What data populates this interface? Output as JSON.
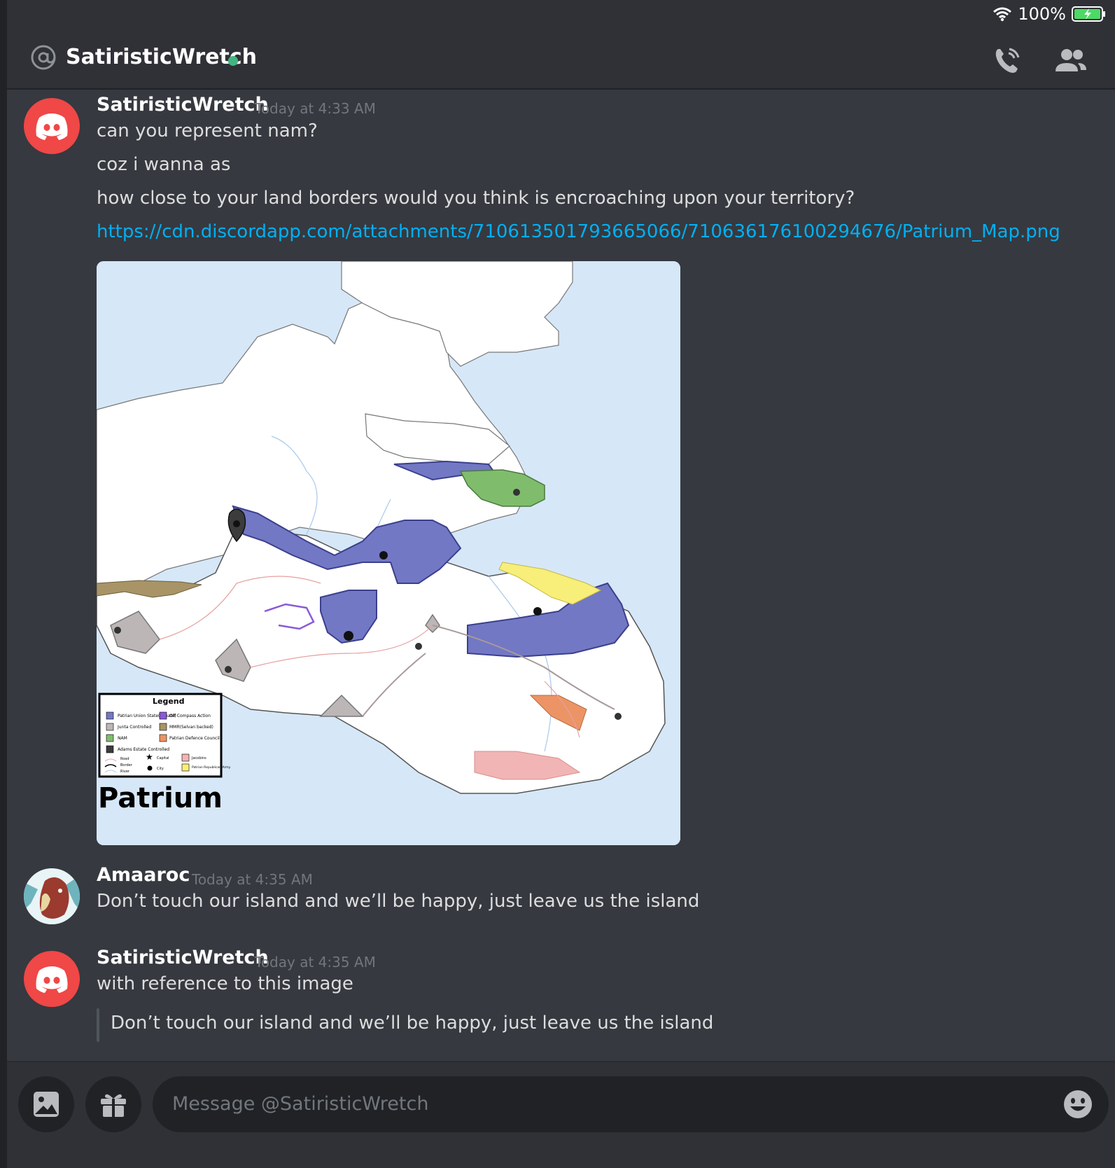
{
  "status_bar": {
    "battery": "100%"
  },
  "header": {
    "channel_name": "SatiristicWretch",
    "status": "online"
  },
  "messages": [
    {
      "author": "SatiristicWretch",
      "timestamp": "Today at 4:33 AM",
      "lines": [
        "can you represent nam?",
        "coz i wanna as",
        "how close to your land borders would you think is encroaching upon your territory?"
      ],
      "link": "https://cdn.discordapp.com/attachments/710613501793665066/710636176100294676/Patrium_Map.png"
    },
    {
      "author": "Amaaroc",
      "timestamp": "Today at 4:35 AM",
      "lines": [
        "Don’t touch our island and we’ll be happy, just leave us the island"
      ]
    },
    {
      "author": "SatiristicWretch",
      "timestamp": "Today at 4:35 AM",
      "lines": [
        "with reference to this image"
      ],
      "quote": "Don’t touch our island and we’ll be happy, just leave us the island"
    }
  ],
  "map": {
    "title": "Patrium",
    "legend_title": "Legend",
    "legend": [
      {
        "label": "Patrian Union State(Senate)",
        "color": "#7278c4"
      },
      {
        "label": "Off Compass Action",
        "color": "#8a5ad6"
      },
      {
        "label": "Junta Controlled",
        "color": "#bdb6b6"
      },
      {
        "label": "MMR(Selvan backed)",
        "color": "#a89466"
      },
      {
        "label": "NAM",
        "color": "#7fbd6c"
      },
      {
        "label": "Patrian Defence Council",
        "color": "#ec9466"
      },
      {
        "label": "Adams Estate Controlled",
        "color": "#3c3c3c"
      },
      {
        "label": "Jacobins",
        "color": "#f1b5b5"
      },
      {
        "label": "Patrian Republican Army",
        "color": "#f8ee7a"
      }
    ],
    "legend_symbols": [
      "Road",
      "Border",
      "River",
      "Capital",
      "City"
    ]
  },
  "composer": {
    "placeholder": "Message @SatiristicWretch"
  },
  "colors": {
    "background": "#36393f",
    "link": "#00b0f4",
    "online": "#43b581",
    "discord_red": "#f04747"
  }
}
